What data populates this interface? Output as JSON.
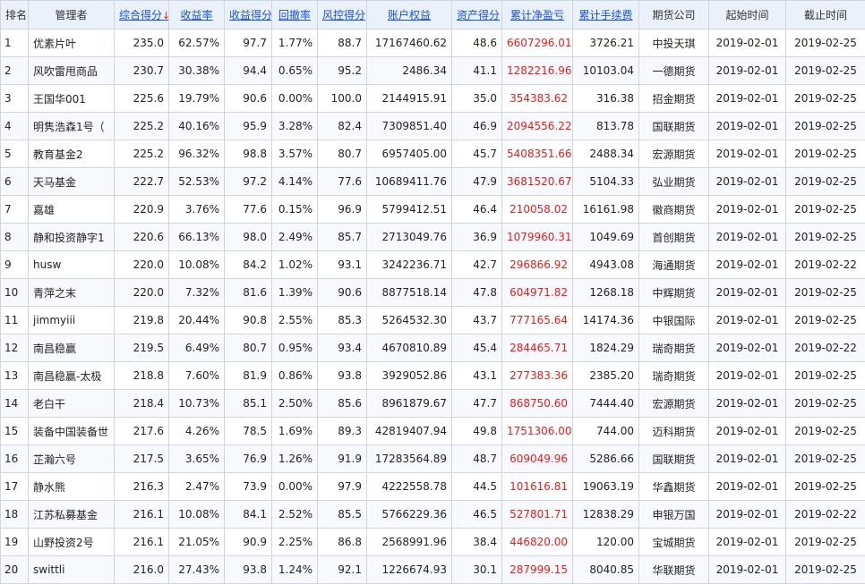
{
  "headers": [
    {
      "key": "rank",
      "label": "排名",
      "sortable": false
    },
    {
      "key": "manager",
      "label": "管理者",
      "sortable": false
    },
    {
      "key": "total_score",
      "label": "综合得分",
      "sortable": true,
      "sorted": true,
      "arrow": "↓"
    },
    {
      "key": "return_rate",
      "label": "收益率",
      "sortable": true
    },
    {
      "key": "return_score",
      "label": "收益得分",
      "sortable": true
    },
    {
      "key": "drawdown",
      "label": "回撤率",
      "sortable": true
    },
    {
      "key": "risk_score",
      "label": "风控得分",
      "sortable": true
    },
    {
      "key": "equity",
      "label": "账户权益",
      "sortable": true
    },
    {
      "key": "asset_score",
      "label": "资产得分",
      "sortable": true
    },
    {
      "key": "net_profit",
      "label": "累计净盈亏",
      "sortable": true
    },
    {
      "key": "fees",
      "label": "累计手续费",
      "sortable": true
    },
    {
      "key": "broker",
      "label": "期货公司",
      "sortable": false
    },
    {
      "key": "start",
      "label": "起始时间",
      "sortable": false
    },
    {
      "key": "end",
      "label": "截止时间",
      "sortable": false
    }
  ],
  "rows": [
    {
      "rank": "1",
      "manager": "优素片叶",
      "total_score": "235.0",
      "return_rate": "62.57%",
      "return_score": "97.7",
      "drawdown": "1.77%",
      "risk_score": "88.7",
      "equity": "17167460.62",
      "asset_score": "48.6",
      "net_profit": "6607296.01",
      "fees": "3726.21",
      "broker": "中投天琪",
      "start": "2019-02-01",
      "end": "2019-02-25"
    },
    {
      "rank": "2",
      "manager": "风吹雷甩商品",
      "total_score": "230.7",
      "return_rate": "30.38%",
      "return_score": "94.4",
      "drawdown": "0.65%",
      "risk_score": "95.2",
      "equity": "2486.34",
      "asset_score": "41.1",
      "net_profit": "1282216.96",
      "fees": "10103.04",
      "broker": "一德期货",
      "start": "2019-02-01",
      "end": "2019-02-25"
    },
    {
      "rank": "3",
      "manager": "王国华001",
      "total_score": "225.6",
      "return_rate": "19.79%",
      "return_score": "90.6",
      "drawdown": "0.00%",
      "risk_score": "100.0",
      "equity": "2144915.91",
      "asset_score": "35.0",
      "net_profit": "354383.62",
      "fees": "316.38",
      "broker": "招金期货",
      "start": "2019-02-01",
      "end": "2019-02-25"
    },
    {
      "rank": "4",
      "manager": "明隽浩森1号（",
      "total_score": "225.2",
      "return_rate": "40.16%",
      "return_score": "95.9",
      "drawdown": "3.28%",
      "risk_score": "82.4",
      "equity": "7309851.40",
      "asset_score": "46.9",
      "net_profit": "2094556.22",
      "fees": "813.78",
      "broker": "国联期货",
      "start": "2019-02-01",
      "end": "2019-02-25"
    },
    {
      "rank": "5",
      "manager": "教育基金2",
      "total_score": "225.2",
      "return_rate": "96.32%",
      "return_score": "98.8",
      "drawdown": "3.57%",
      "risk_score": "80.7",
      "equity": "6957405.00",
      "asset_score": "45.7",
      "net_profit": "5408351.66",
      "fees": "2488.34",
      "broker": "宏源期货",
      "start": "2019-02-01",
      "end": "2019-02-25"
    },
    {
      "rank": "6",
      "manager": "天马基金",
      "total_score": "222.7",
      "return_rate": "52.53%",
      "return_score": "97.2",
      "drawdown": "4.14%",
      "risk_score": "77.6",
      "equity": "10689411.76",
      "asset_score": "47.9",
      "net_profit": "3681520.67",
      "fees": "5104.33",
      "broker": "弘业期货",
      "start": "2019-02-01",
      "end": "2019-02-25"
    },
    {
      "rank": "7",
      "manager": "嘉雄",
      "total_score": "220.9",
      "return_rate": "3.76%",
      "return_score": "77.6",
      "drawdown": "0.15%",
      "risk_score": "96.9",
      "equity": "5799412.51",
      "asset_score": "46.4",
      "net_profit": "210058.02",
      "fees": "16161.98",
      "broker": "徽商期货",
      "start": "2019-02-01",
      "end": "2019-02-25"
    },
    {
      "rank": "8",
      "manager": "静和投资静字1",
      "total_score": "220.6",
      "return_rate": "66.13%",
      "return_score": "98.0",
      "drawdown": "2.49%",
      "risk_score": "85.7",
      "equity": "2713049.76",
      "asset_score": "36.9",
      "net_profit": "1079960.31",
      "fees": "1049.69",
      "broker": "首创期货",
      "start": "2019-02-01",
      "end": "2019-02-25"
    },
    {
      "rank": "9",
      "manager": "husw",
      "total_score": "220.0",
      "return_rate": "10.08%",
      "return_score": "84.2",
      "drawdown": "1.02%",
      "risk_score": "93.1",
      "equity": "3242236.71",
      "asset_score": "42.7",
      "net_profit": "296866.92",
      "fees": "4943.08",
      "broker": "海通期货",
      "start": "2019-02-01",
      "end": "2019-02-22"
    },
    {
      "rank": "10",
      "manager": "青萍之末",
      "total_score": "220.0",
      "return_rate": "7.32%",
      "return_score": "81.6",
      "drawdown": "1.39%",
      "risk_score": "90.6",
      "equity": "8877518.14",
      "asset_score": "47.8",
      "net_profit": "604971.82",
      "fees": "1268.18",
      "broker": "中辉期货",
      "start": "2019-02-01",
      "end": "2019-02-25"
    },
    {
      "rank": "11",
      "manager": "jimmyiii",
      "total_score": "219.8",
      "return_rate": "20.44%",
      "return_score": "90.8",
      "drawdown": "2.55%",
      "risk_score": "85.3",
      "equity": "5264532.30",
      "asset_score": "43.7",
      "net_profit": "777165.64",
      "fees": "14174.36",
      "broker": "中银国际",
      "start": "2019-02-01",
      "end": "2019-02-25"
    },
    {
      "rank": "12",
      "manager": "南昌稳赢",
      "total_score": "219.5",
      "return_rate": "6.49%",
      "return_score": "80.7",
      "drawdown": "0.95%",
      "risk_score": "93.4",
      "equity": "4670810.89",
      "asset_score": "45.4",
      "net_profit": "284465.71",
      "fees": "1824.29",
      "broker": "瑞奇期货",
      "start": "2019-02-01",
      "end": "2019-02-22"
    },
    {
      "rank": "13",
      "manager": "南昌稳赢-太极",
      "total_score": "218.8",
      "return_rate": "7.60%",
      "return_score": "81.9",
      "drawdown": "0.86%",
      "risk_score": "93.8",
      "equity": "3929052.86",
      "asset_score": "43.1",
      "net_profit": "277383.36",
      "fees": "2385.20",
      "broker": "瑞奇期货",
      "start": "2019-02-01",
      "end": "2019-02-25"
    },
    {
      "rank": "14",
      "manager": "老白干",
      "total_score": "218.4",
      "return_rate": "10.73%",
      "return_score": "85.1",
      "drawdown": "2.50%",
      "risk_score": "85.6",
      "equity": "8961879.67",
      "asset_score": "47.7",
      "net_profit": "868750.60",
      "fees": "7444.40",
      "broker": "宏源期货",
      "start": "2019-02-01",
      "end": "2019-02-25"
    },
    {
      "rank": "15",
      "manager": "装备中国装备世",
      "total_score": "217.6",
      "return_rate": "4.26%",
      "return_score": "78.5",
      "drawdown": "1.69%",
      "risk_score": "89.3",
      "equity": "42819407.94",
      "asset_score": "49.8",
      "net_profit": "1751306.00",
      "fees": "744.00",
      "broker": "迈科期货",
      "start": "2019-02-01",
      "end": "2019-02-25"
    },
    {
      "rank": "16",
      "manager": "芷瀚六号",
      "total_score": "217.5",
      "return_rate": "3.65%",
      "return_score": "76.9",
      "drawdown": "1.26%",
      "risk_score": "91.9",
      "equity": "17283564.89",
      "asset_score": "48.7",
      "net_profit": "609049.96",
      "fees": "5286.66",
      "broker": "国联期货",
      "start": "2019-02-01",
      "end": "2019-02-25"
    },
    {
      "rank": "17",
      "manager": "静水熊",
      "total_score": "216.3",
      "return_rate": "2.47%",
      "return_score": "73.9",
      "drawdown": "0.00%",
      "risk_score": "97.9",
      "equity": "4222558.78",
      "asset_score": "44.5",
      "net_profit": "101616.81",
      "fees": "19063.19",
      "broker": "华鑫期货",
      "start": "2019-02-01",
      "end": "2019-02-25"
    },
    {
      "rank": "18",
      "manager": "江苏私募基金",
      "total_score": "216.1",
      "return_rate": "10.08%",
      "return_score": "84.1",
      "drawdown": "2.52%",
      "risk_score": "85.5",
      "equity": "5766229.36",
      "asset_score": "46.5",
      "net_profit": "527801.71",
      "fees": "12838.29",
      "broker": "申银万国",
      "start": "2019-02-01",
      "end": "2019-02-22"
    },
    {
      "rank": "19",
      "manager": "山野投资2号",
      "total_score": "216.1",
      "return_rate": "21.05%",
      "return_score": "90.9",
      "drawdown": "2.25%",
      "risk_score": "86.8",
      "equity": "2568991.96",
      "asset_score": "38.4",
      "net_profit": "446820.00",
      "fees": "120.00",
      "broker": "宝城期货",
      "start": "2019-02-01",
      "end": "2019-02-25"
    },
    {
      "rank": "20",
      "manager": "swittli",
      "total_score": "216.0",
      "return_rate": "27.43%",
      "return_score": "93.8",
      "drawdown": "1.24%",
      "risk_score": "92.1",
      "equity": "1226674.93",
      "asset_score": "30.1",
      "net_profit": "287999.15",
      "fees": "8040.85",
      "broker": "华联期货",
      "start": "2019-02-01",
      "end": "2019-02-25"
    }
  ],
  "colors": {
    "header_bg": "#eaf1fb",
    "link": "#1a53d6",
    "profit": "#e02020",
    "border": "#cfd6df"
  }
}
